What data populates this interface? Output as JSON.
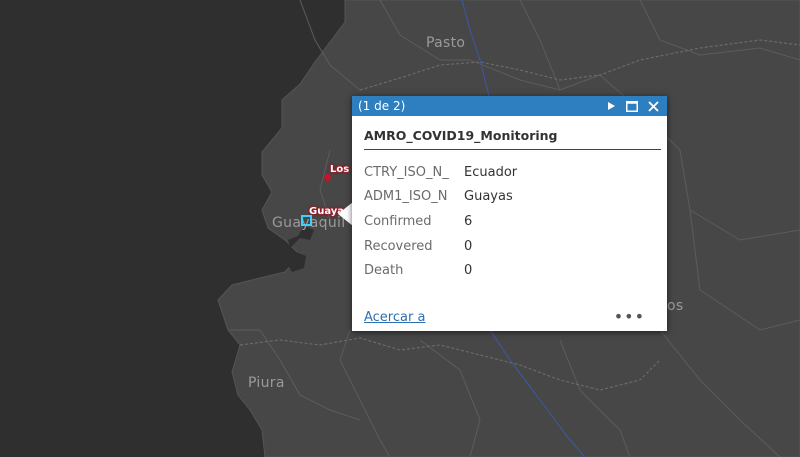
{
  "map": {
    "colors": {
      "ocean": "#2f2f2f",
      "land": "#474747",
      "borders": "#5a5a5a",
      "route": "#3d58a8",
      "marker": "#c0182a",
      "selection": "#3fd0ff"
    },
    "city_labels": {
      "pasto": "Pasto",
      "guayaquil": "Guayaquil",
      "piura": "Piura",
      "partial_os": "os"
    },
    "feature_labels": {
      "los": "Los",
      "guayas": "Guaya"
    }
  },
  "popup": {
    "counter": "(1 de 2)",
    "title": "AMRO_COVID19_Monitoring",
    "fields": [
      {
        "key": "CTRY_ISO_N_",
        "value": "Ecuador"
      },
      {
        "key": "ADM1_ISO_N",
        "value": "Guayas"
      },
      {
        "key": "Confirmed",
        "value": "6"
      },
      {
        "key": "Recovered",
        "value": "0"
      },
      {
        "key": "Death",
        "value": "0"
      }
    ],
    "zoom_link": "Acercar a",
    "more": "•••",
    "header_color": "#2d7fc0",
    "icons": [
      "next-icon",
      "maximize-icon",
      "close-icon"
    ]
  }
}
